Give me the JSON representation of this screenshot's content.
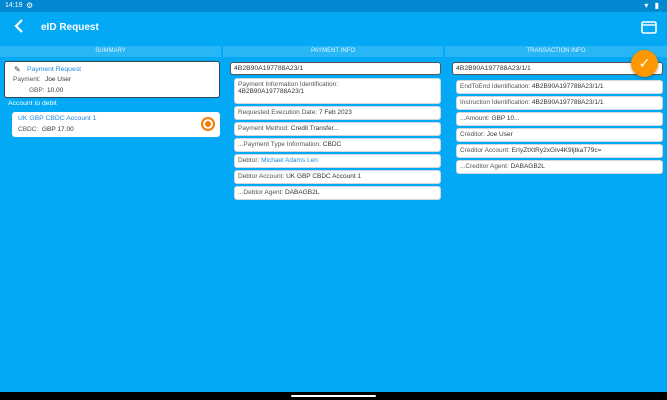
{
  "status": {
    "time": "14:19",
    "sys_icon": "⚙",
    "right_icons": "▾ ▮"
  },
  "app": {
    "title": "eID Request"
  },
  "columns": {
    "summary": "SUMMARY",
    "payment": "PAYMENT INFO",
    "transaction": "TRANSACTION INFO"
  },
  "summary": {
    "title": "Payment Request",
    "payment_label": "Payment:",
    "payment_value": "Joe User",
    "currency": "GBP:",
    "amount": "10.00",
    "debit_label": "Account to debit",
    "account_name": "UK GBP CBDC Account 1",
    "account_currency": "CBDC:",
    "account_balance": "GBP 17.00"
  },
  "payment": {
    "id_header": "4B2B90A197788A23/1",
    "fields": [
      {
        "label": "Payment Information Identification:",
        "value": "4B2B90A197788A23/1"
      },
      {
        "label": "Requested Execution Date:",
        "value": "7 Feb 2023"
      },
      {
        "label": "Payment Method:",
        "value": "Credit Transfer..."
      },
      {
        "label": "...Payment Type Information:",
        "value": "CBDC"
      },
      {
        "label": "Debtor:",
        "value": "Michael Adams Len"
      },
      {
        "label": "Debtor Account:",
        "value": "UK GBP CBDC Account 1"
      },
      {
        "label": "...Debtor Agent:",
        "value": "DABAGB2L"
      }
    ]
  },
  "transaction": {
    "id_header": "4B2B90A197788A23/1/1",
    "fields": [
      {
        "label": "EndToEnd Identification:",
        "value": "4B2B90A197788A23/1/1"
      },
      {
        "label": "Instruction Identification:",
        "value": "4B2B90A197788A23/1/1"
      },
      {
        "label": "...Amount:",
        "value": "GBP 10..."
      },
      {
        "label": "Creditor:",
        "value": "Joe User"
      },
      {
        "label": "Creditor Account:",
        "value": "ErIyZtXtRy2xGIv4K9ljtkaT79c="
      },
      {
        "label": "...Creditor Agent:",
        "value": "DABAGB2L"
      }
    ]
  },
  "colors": {
    "background": "#03a9f4",
    "accent": "#ff9800",
    "link": "#1e88e5"
  }
}
